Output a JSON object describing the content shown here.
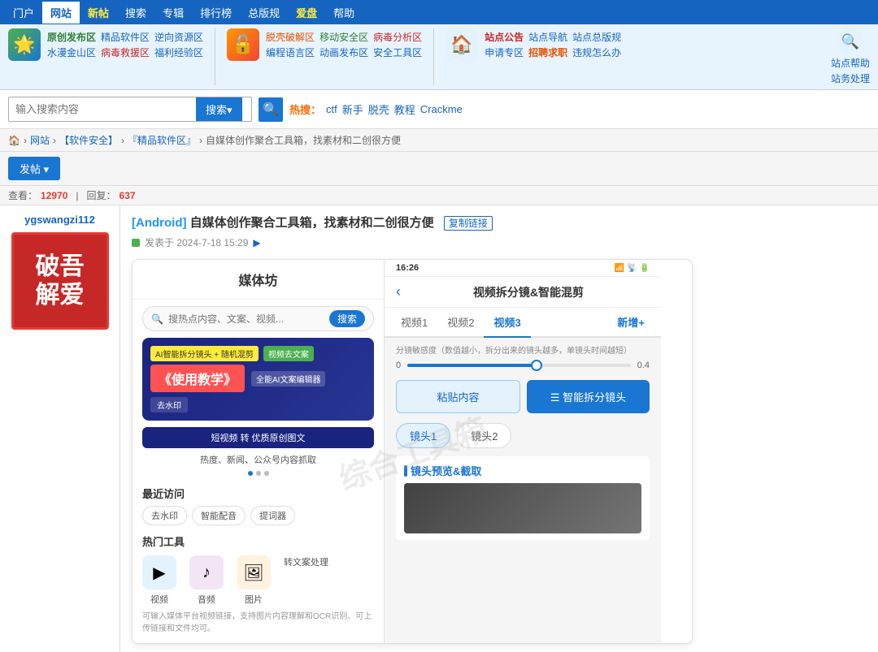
{
  "topNav": {
    "items": [
      {
        "label": "门户",
        "active": false
      },
      {
        "label": "网站",
        "active": true
      },
      {
        "label": "新帖",
        "active": false
      },
      {
        "label": "搜索",
        "active": false
      },
      {
        "label": "专辑",
        "active": false
      },
      {
        "label": "排行榜",
        "active": false
      },
      {
        "label": "总版规",
        "active": false
      },
      {
        "label": "爱盘",
        "highlight": true,
        "active": false
      },
      {
        "label": "帮助",
        "active": false
      }
    ]
  },
  "promoBar": {
    "sections": [
      {
        "links": [
          {
            "text": "原创发布区",
            "class": "green"
          },
          {
            "text": "精品软件区",
            "class": "blue"
          },
          {
            "text": "逆向资源区",
            "class": "blue"
          }
        ]
      },
      {
        "links": [
          {
            "text": "水漫金山区",
            "class": "blue"
          },
          {
            "text": "病毒救援区",
            "class": "red"
          },
          {
            "text": "福利经验区",
            "class": "blue"
          }
        ]
      }
    ],
    "promoLinks2": [
      {
        "text": "脱壳破解区",
        "class": "orange"
      },
      {
        "text": "移动安全区",
        "class": "green"
      },
      {
        "text": "病毒分析区",
        "class": "red"
      },
      {
        "text": "编程语言区",
        "class": "blue"
      },
      {
        "text": "动画发布区",
        "class": "blue"
      },
      {
        "text": "安全工具区",
        "class": "blue"
      }
    ],
    "right": {
      "stationNotice": "站点公告",
      "stationNav": "站点导航",
      "stationTotal": "站点总版规",
      "applySpecial": "申请专区",
      "recruit": "招聘求职",
      "violation": "违规怎么办",
      "helpLabel": "站点帮助",
      "stationProcess": "站务处理"
    }
  },
  "searchBar": {
    "placeholder": "输入搜索内容",
    "btnLabel": "搜索▾",
    "hotLabel": "热搜：",
    "hotItems": [
      "ctf",
      "新手",
      "脱壳",
      "教程",
      "Crackme"
    ]
  },
  "breadcrumb": {
    "items": [
      {
        "text": "🏠",
        "link": true
      },
      {
        "text": "网站",
        "link": true
      },
      {
        "text": "【软件安全】",
        "link": true
      },
      {
        "text": "『精品软件区』",
        "link": true
      },
      {
        "text": "自媒体创作聚合工具箱，找素材和二创很方便",
        "link": false
      }
    ]
  },
  "postBtn": {
    "label": "发帖 ▾"
  },
  "statsBar": {
    "viewLabel": "查看：",
    "viewValue": "12970",
    "replyLabel": "回复：",
    "replyValue": "637"
  },
  "postTitle": {
    "tag": "[Android]",
    "text": " 自媒体创作聚合工具箱，找素材和二创很方便",
    "copyLink": "复制链接"
  },
  "postMeta": {
    "dateText": "发表于 2024-7-18 15:29"
  },
  "sidebar": {
    "username": "ygswangzi112",
    "avatarLine1": "破吾",
    "avatarLine2": "解爱"
  },
  "appPreview": {
    "leftTitle": "媒体坊",
    "searchPlaceholder": "搜热点内容、文案、视频...",
    "searchBtn": "搜索",
    "bannerTags": [
      "AI智能拆分镜头 + 随机混剪",
      "视频去文案"
    ],
    "bannerMain": "《使用教学》",
    "bannerSub1": "全能AI文案编辑器",
    "bannerBtn1": "去水印",
    "convertBar": "短视频 转 优质原创图文",
    "bannerMore": "热度、新闻、公众号内容抓取",
    "recentTitle": "最近访问",
    "recentItems": [
      "去水印",
      "智能配音",
      "提词器"
    ],
    "hotTitle": "热门工具",
    "hotItems": [
      {
        "icon": "▶",
        "color": "blue",
        "label": "视频"
      },
      {
        "icon": "♪",
        "color": "purple",
        "label": "音频"
      },
      {
        "icon": "🖼",
        "color": "orange",
        "label": "图片"
      },
      {
        "label": "转文案处理"
      }
    ],
    "hotDesc": "可输入媒体平台视频链接，支持图片内容理解和OCR识别、可上传链接和文件均可。"
  },
  "phonePreview": {
    "time": "16:26",
    "statusIcons": "🔋",
    "title": "视频拆分镜&智能混剪",
    "tabs": [
      "视频1",
      "视频2",
      "视频3",
      "新增+"
    ],
    "activeTab": "视频3",
    "sensitivityLabel": "分镜敏感度（数值越小，拆分出来的镜头越多，单镜头时间越短）",
    "sliderMin": "0",
    "sliderMax": "0.4",
    "pasteBtnLabel": "粘贴内容",
    "splitBtnLabel": "☰ 智能拆分镜头",
    "clipTabs": [
      "镜头1",
      "镜头2"
    ],
    "previewTitle": "镜头预览&截取"
  }
}
